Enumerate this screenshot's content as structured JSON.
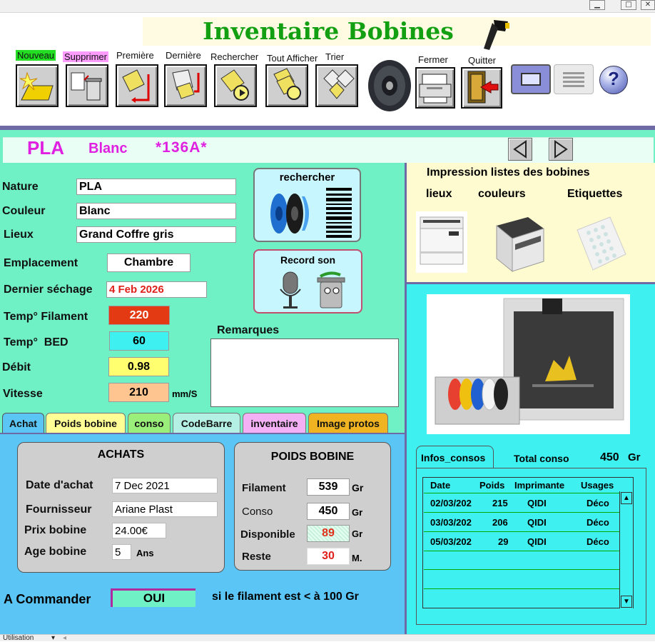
{
  "app": {
    "title": "Inventaire Bobines"
  },
  "toolbar": {
    "nouveau": "Nouveau",
    "supprimer": "Supprimer",
    "premiere": "Première",
    "derniere": "Dernière",
    "rechercher": "Rechercher",
    "tout_afficher": "Tout Afficher",
    "trier": "Trier",
    "fermer": "Fermer",
    "quitter": "Quitter"
  },
  "header": {
    "type": "PLA",
    "color": "Blanc",
    "code": "*136A*"
  },
  "form": {
    "nature_label": "Nature",
    "nature": "PLA",
    "couleur_label": "Couleur",
    "couleur": "Blanc",
    "lieux_label": "Lieux",
    "lieux": "Grand Coffre gris",
    "emplacement_label": "Emplacement",
    "emplacement": "Chambre",
    "sechage_label": "Dernier séchage",
    "sechage": "4 Feb 2026",
    "temp_fil_label": "Temp° Filament",
    "temp_fil": "220",
    "temp_bed_label": "Temp°  BED",
    "temp_bed": "60",
    "debit_label": "Débit",
    "debit": "0.98",
    "vitesse_label": "Vitesse",
    "vitesse": "210",
    "vitesse_unit": "mm/S",
    "remarques_label": "Remarques"
  },
  "search_btn": {
    "label": "rechercher"
  },
  "record_btn": {
    "label": "Record son"
  },
  "print_panel": {
    "title": "Impression listes des bobines",
    "lieux": "lieux",
    "couleurs": "couleurs",
    "etiquettes": "Etiquettes"
  },
  "tabs": [
    "Achat",
    "Poids bobine",
    "conso",
    "CodeBarre",
    "inventaire",
    "Image protos"
  ],
  "achats": {
    "title": "ACHATS",
    "date_label": "Date d'achat",
    "date": "7 Dec 2021",
    "fournisseur_label": "Fournisseur",
    "fournisseur": "Ariane Plast",
    "prix_label": "Prix bobine",
    "prix": "24.00€",
    "age_label": "Age bobine",
    "age": "5",
    "age_unit": "Ans"
  },
  "poids": {
    "title": "POIDS BOBINE",
    "filament_label": "Filament",
    "filament": "539",
    "conso_label": "Conso",
    "conso": "450",
    "dispo_label": "Disponible",
    "dispo": "89",
    "reste_label": "Reste",
    "reste": "30",
    "unit": "Gr",
    "unit_m": "M."
  },
  "commande": {
    "label": "A Commander",
    "value": "OUI",
    "note": "si le filament est < à 100 Gr"
  },
  "consos": {
    "tab": "Infos_consos",
    "total_label": "Total conso",
    "total": "450",
    "total_unit": "Gr",
    "columns": [
      "Date",
      "Poids",
      "Imprimante",
      "Usages"
    ],
    "rows": [
      [
        "02/03/202",
        "215",
        "QIDI",
        "Déco"
      ],
      [
        "03/03/202",
        "206",
        "QIDI",
        "Déco"
      ],
      [
        "05/03/202",
        "29",
        "QIDI",
        "Déco"
      ]
    ]
  },
  "status": {
    "mode": "Utilisation"
  },
  "colors": {
    "title_green": "#12a012",
    "magenta": "#e020e0",
    "mint": "#6ff0c5",
    "cyan": "#3ef0f0",
    "blue": "#5bc6f5"
  }
}
